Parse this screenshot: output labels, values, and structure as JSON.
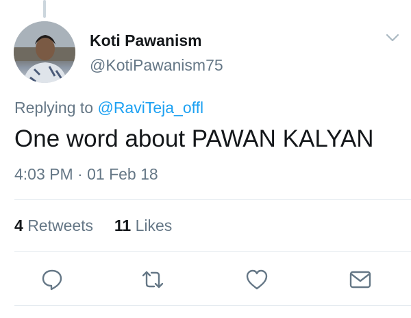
{
  "tweet": {
    "author_name": "Koti Pawanism",
    "author_handle": "@KotiPawanism75",
    "replying_prefix": "Replying to",
    "replying_to": "@RaviTeja_offl",
    "text": "One word about PAWAN KALYAN",
    "timestamp": "4:03 PM · 01 Feb 18"
  },
  "stats": {
    "retweets_count": "4",
    "retweets_label": "Retweets",
    "likes_count": "11",
    "likes_label": "Likes"
  },
  "actions": {
    "reply_icon": "reply-icon",
    "retweet_icon": "retweet-icon",
    "like_icon": "heart-icon",
    "share_icon": "envelope-icon"
  },
  "colors": {
    "link": "#1da1f2",
    "secondary_text": "#657786",
    "primary_text": "#14171a",
    "divider": "#e1e8ed"
  }
}
